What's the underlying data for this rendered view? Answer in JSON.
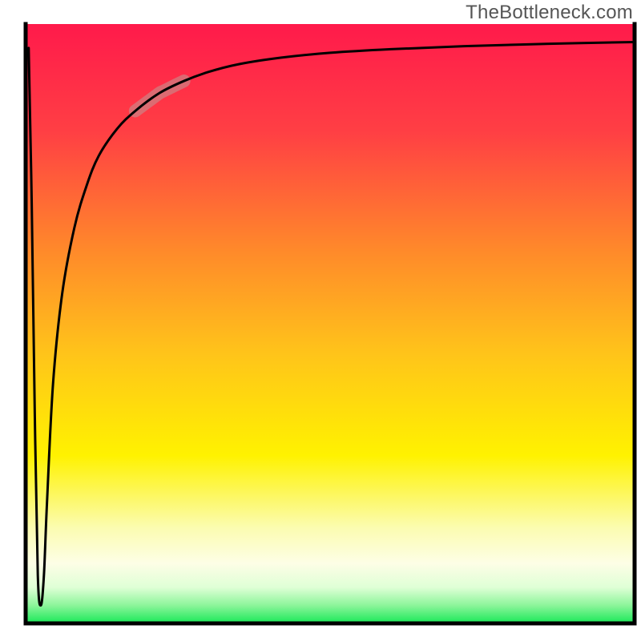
{
  "watermark": "TheBottleneck.com",
  "chart_data": {
    "type": "line",
    "title": "",
    "xlabel": "",
    "ylabel": "",
    "xlim": [
      0,
      100
    ],
    "ylim": [
      0,
      100
    ],
    "background_gradient": {
      "stops": [
        {
          "offset": 0.0,
          "color": "#ff1a4b"
        },
        {
          "offset": 0.18,
          "color": "#ff3f44"
        },
        {
          "offset": 0.38,
          "color": "#ff8a2a"
        },
        {
          "offset": 0.55,
          "color": "#ffc41a"
        },
        {
          "offset": 0.72,
          "color": "#fff200"
        },
        {
          "offset": 0.84,
          "color": "#fbfcb0"
        },
        {
          "offset": 0.9,
          "color": "#fdfee6"
        },
        {
          "offset": 0.94,
          "color": "#dfffd6"
        },
        {
          "offset": 0.97,
          "color": "#8cf59a"
        },
        {
          "offset": 1.0,
          "color": "#18e858"
        }
      ]
    },
    "series": [
      {
        "name": "curve",
        "x": [
          0.5,
          1.0,
          1.5,
          2.0,
          2.5,
          3.0,
          3.5,
          4.5,
          6.0,
          8.0,
          10.0,
          12.0,
          15.0,
          18.0,
          22.0,
          26.0,
          30.0,
          35.0,
          42.0,
          50.0,
          60.0,
          72.0,
          86.0,
          100.0
        ],
        "y": [
          96.0,
          70.0,
          35.0,
          8.0,
          3.0,
          8.0,
          20.0,
          40.0,
          55.0,
          66.0,
          73.0,
          78.0,
          82.5,
          85.5,
          88.5,
          90.5,
          92.0,
          93.3,
          94.4,
          95.2,
          95.8,
          96.3,
          96.7,
          97.0
        ]
      }
    ],
    "highlight_segment": {
      "series": "curve",
      "x_start": 18.0,
      "x_end": 26.0,
      "color": "#c78a8a",
      "opacity": 0.65,
      "width": 16
    },
    "axes": {
      "stroke": "#000000",
      "width": 5,
      "ticks": false,
      "grid": false
    }
  }
}
